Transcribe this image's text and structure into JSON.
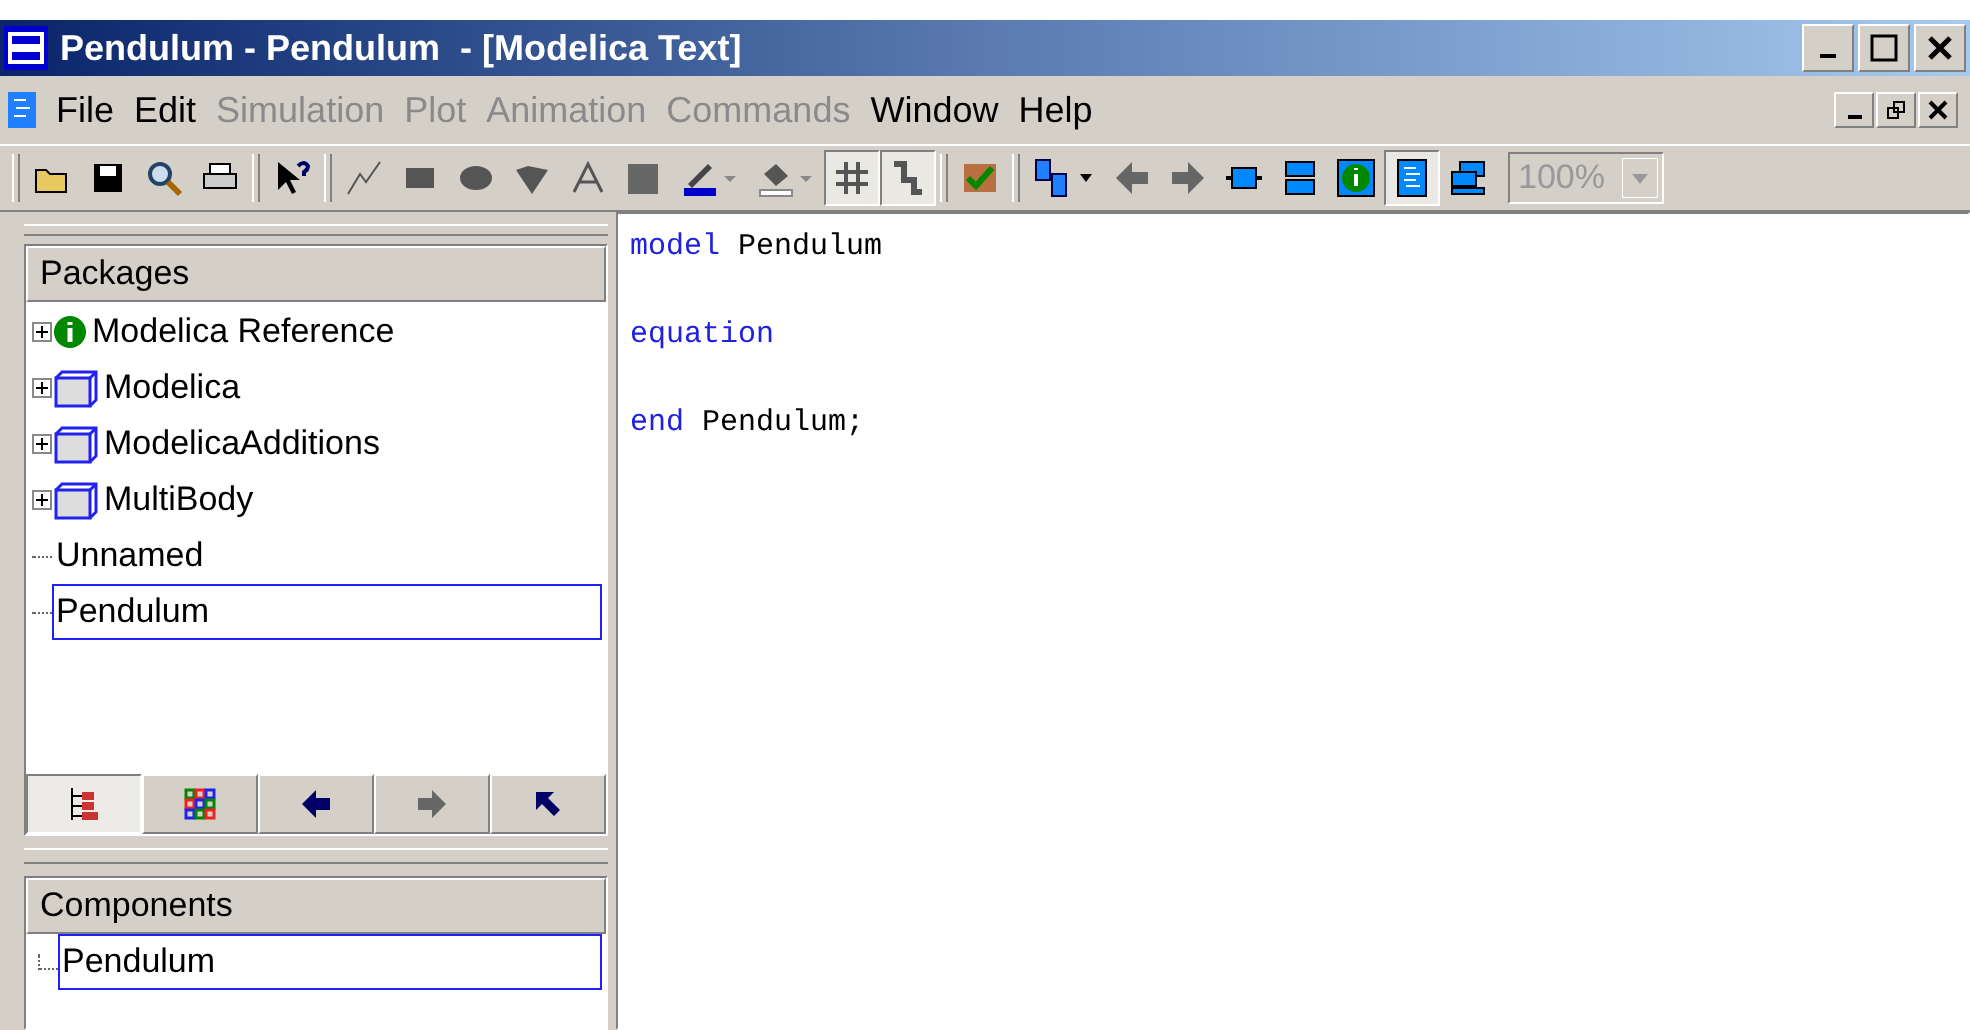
{
  "window": {
    "title": "Pendulum - Pendulum  - [Modelica Text]"
  },
  "menu": [
    {
      "label": "File",
      "disabled": false
    },
    {
      "label": "Edit",
      "disabled": false
    },
    {
      "label": "Simulation",
      "disabled": true
    },
    {
      "label": "Plot",
      "disabled": true
    },
    {
      "label": "Animation",
      "disabled": true
    },
    {
      "label": "Commands",
      "disabled": true
    },
    {
      "label": "Window",
      "disabled": false
    },
    {
      "label": "Help",
      "disabled": false
    }
  ],
  "toolbar": [
    {
      "kind": "open",
      "selected": false
    },
    {
      "kind": "save",
      "selected": false
    },
    {
      "kind": "search",
      "selected": false
    },
    {
      "kind": "print",
      "selected": false
    },
    {
      "kind": "sep"
    },
    {
      "kind": "help",
      "selected": false
    },
    {
      "kind": "sep"
    },
    {
      "kind": "line",
      "selected": false
    },
    {
      "kind": "rect",
      "selected": false
    },
    {
      "kind": "ellipse",
      "selected": false
    },
    {
      "kind": "polygon",
      "selected": false
    },
    {
      "kind": "text",
      "selected": false
    },
    {
      "kind": "bitmap",
      "selected": false
    },
    {
      "kind": "linecolor",
      "selected": false
    },
    {
      "kind": "fillcolor",
      "selected": false
    },
    {
      "kind": "grid",
      "selected": true
    },
    {
      "kind": "connect",
      "selected": true
    },
    {
      "kind": "sep"
    },
    {
      "kind": "check",
      "selected": false
    },
    {
      "kind": "sep"
    },
    {
      "kind": "diagram",
      "selected": false
    },
    {
      "kind": "back",
      "selected": false
    },
    {
      "kind": "forward",
      "selected": false
    },
    {
      "kind": "block",
      "selected": false
    },
    {
      "kind": "layers",
      "selected": false
    },
    {
      "kind": "info",
      "selected": false
    },
    {
      "kind": "textview",
      "selected": true
    },
    {
      "kind": "stack",
      "selected": false
    }
  ],
  "zoom": {
    "value": "100%",
    "disabled": true
  },
  "packages": {
    "title": "Packages",
    "items": [
      {
        "label": "Modelica Reference",
        "kind": "info",
        "expandable": true,
        "selected": false
      },
      {
        "label": "Modelica",
        "kind": "package",
        "expandable": true,
        "selected": false
      },
      {
        "label": "ModelicaAdditions",
        "kind": "package",
        "expandable": true,
        "selected": false
      },
      {
        "label": "MultiBody",
        "kind": "package",
        "expandable": true,
        "selected": false
      },
      {
        "label": "Unnamed",
        "kind": "model",
        "expandable": false,
        "selected": false
      },
      {
        "label": "Pendulum",
        "kind": "model",
        "expandable": false,
        "selected": true
      }
    ]
  },
  "browser_tabs": [
    {
      "kind": "tree",
      "selected": true
    },
    {
      "kind": "icons",
      "selected": false
    },
    {
      "kind": "back",
      "selected": false
    },
    {
      "kind": "forward",
      "selected": false
    },
    {
      "kind": "up",
      "selected": false
    }
  ],
  "components": {
    "title": "Components",
    "items": [
      {
        "label": "Pendulum",
        "selected": true
      }
    ]
  },
  "code": [
    [
      {
        "kind": "keyword",
        "text": "model"
      },
      {
        "kind": "plain",
        "text": " Pendulum"
      }
    ],
    [
      {
        "kind": "keyword",
        "text": "equation"
      }
    ],
    [
      {
        "kind": "keyword",
        "text": "end"
      },
      {
        "kind": "plain",
        "text": " Pendulum;"
      }
    ]
  ]
}
